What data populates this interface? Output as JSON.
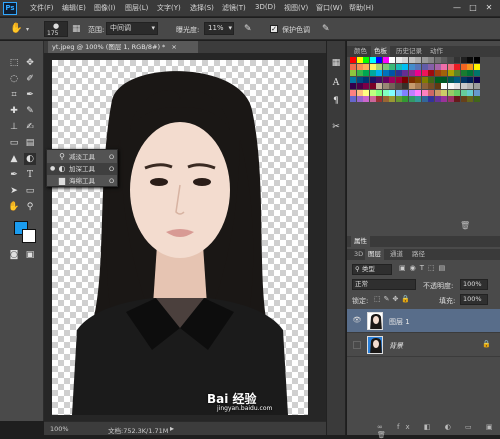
{
  "app": {
    "logo": "Ps"
  },
  "menu": [
    "文件(F)",
    "编辑(E)",
    "图像(I)",
    "图层(L)",
    "文字(Y)",
    "选择(S)",
    "滤镜(T)",
    "3D(D)",
    "视图(V)",
    "窗口(W)",
    "帮助(H)"
  ],
  "window_controls": [
    "—",
    "□",
    "✕"
  ],
  "options": {
    "brush_size": "175",
    "range_label": "范围:",
    "range_value": "中间调",
    "exposure_label": "曝光度:",
    "exposure_value": "11%",
    "protect_tones_label": "保护色调",
    "protect_tones_checked": true
  },
  "document": {
    "tab_title": "yt.jpeg @ 100% (图层 1, RGB/8#) *",
    "close": "×"
  },
  "flyout": [
    {
      "icon": "dodge-tool-icon",
      "label": "减淡工具",
      "key": "O",
      "selected": false
    },
    {
      "icon": "burn-tool-icon",
      "label": "加深工具",
      "key": "O",
      "selected": true
    },
    {
      "icon": "sponge-tool-icon",
      "label": "海绵工具",
      "key": "O",
      "selected": false
    }
  ],
  "status": {
    "zoom": "100%",
    "doc": "文档:752.3K/1.71M"
  },
  "colors": {
    "foreground": "#1a9cf0",
    "background": "#ffffff"
  },
  "panels": {
    "swatch_tabs": [
      "颜色",
      "色板",
      "历史记录",
      "动作"
    ],
    "swatch_active": 1,
    "properties_tab": "属性",
    "layer_tabs": [
      "3D",
      "图层",
      "通道",
      "路径"
    ],
    "layer_active": 1,
    "filter_kind": "类型",
    "blend_mode": "正常",
    "opacity_label": "不透明度:",
    "opacity_value": "100%",
    "lock_label": "锁定:",
    "fill_label": "填充:",
    "fill_value": "100%",
    "layers": [
      {
        "name": "图层 1",
        "visible": true,
        "active": true
      },
      {
        "name": "背景",
        "visible": false,
        "active": false,
        "locked": true
      }
    ]
  },
  "watermark": {
    "brand": "Bai 经验",
    "url": "jingyan.baidu.com"
  }
}
